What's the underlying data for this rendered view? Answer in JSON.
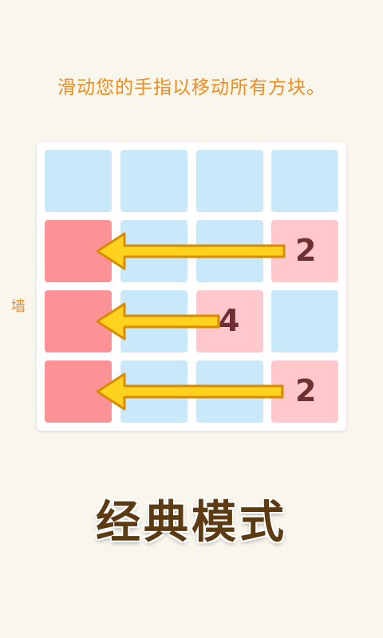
{
  "instruction": "滑动您的手指以移动所有方块。",
  "wall_label": "墙",
  "mode_title": "经典模式",
  "board": {
    "rows": [
      [
        "empty",
        "empty",
        "empty",
        "empty"
      ],
      [
        "wall",
        "empty",
        "empty",
        "num"
      ],
      [
        "wall",
        "empty",
        "num",
        "empty"
      ],
      [
        "wall",
        "empty",
        "empty",
        "num"
      ]
    ],
    "values": [
      {
        "row": 1,
        "col": 3,
        "value": "2"
      },
      {
        "row": 2,
        "col": 2,
        "value": "4"
      },
      {
        "row": 3,
        "col": 3,
        "value": "2"
      }
    ]
  },
  "colors": {
    "empty_tile": "#c9e8f9",
    "wall_tile": "#fc9295",
    "number_tile": "#ffc8cc",
    "arrow_fill": "#ffd21e",
    "arrow_stroke": "#d88a00",
    "instruction_text": "#f08c1e",
    "title_text": "#5c3a12"
  },
  "arrows": [
    {
      "direction": "left",
      "row": 1
    },
    {
      "direction": "left",
      "row": 2
    },
    {
      "direction": "left",
      "row": 3
    }
  ]
}
